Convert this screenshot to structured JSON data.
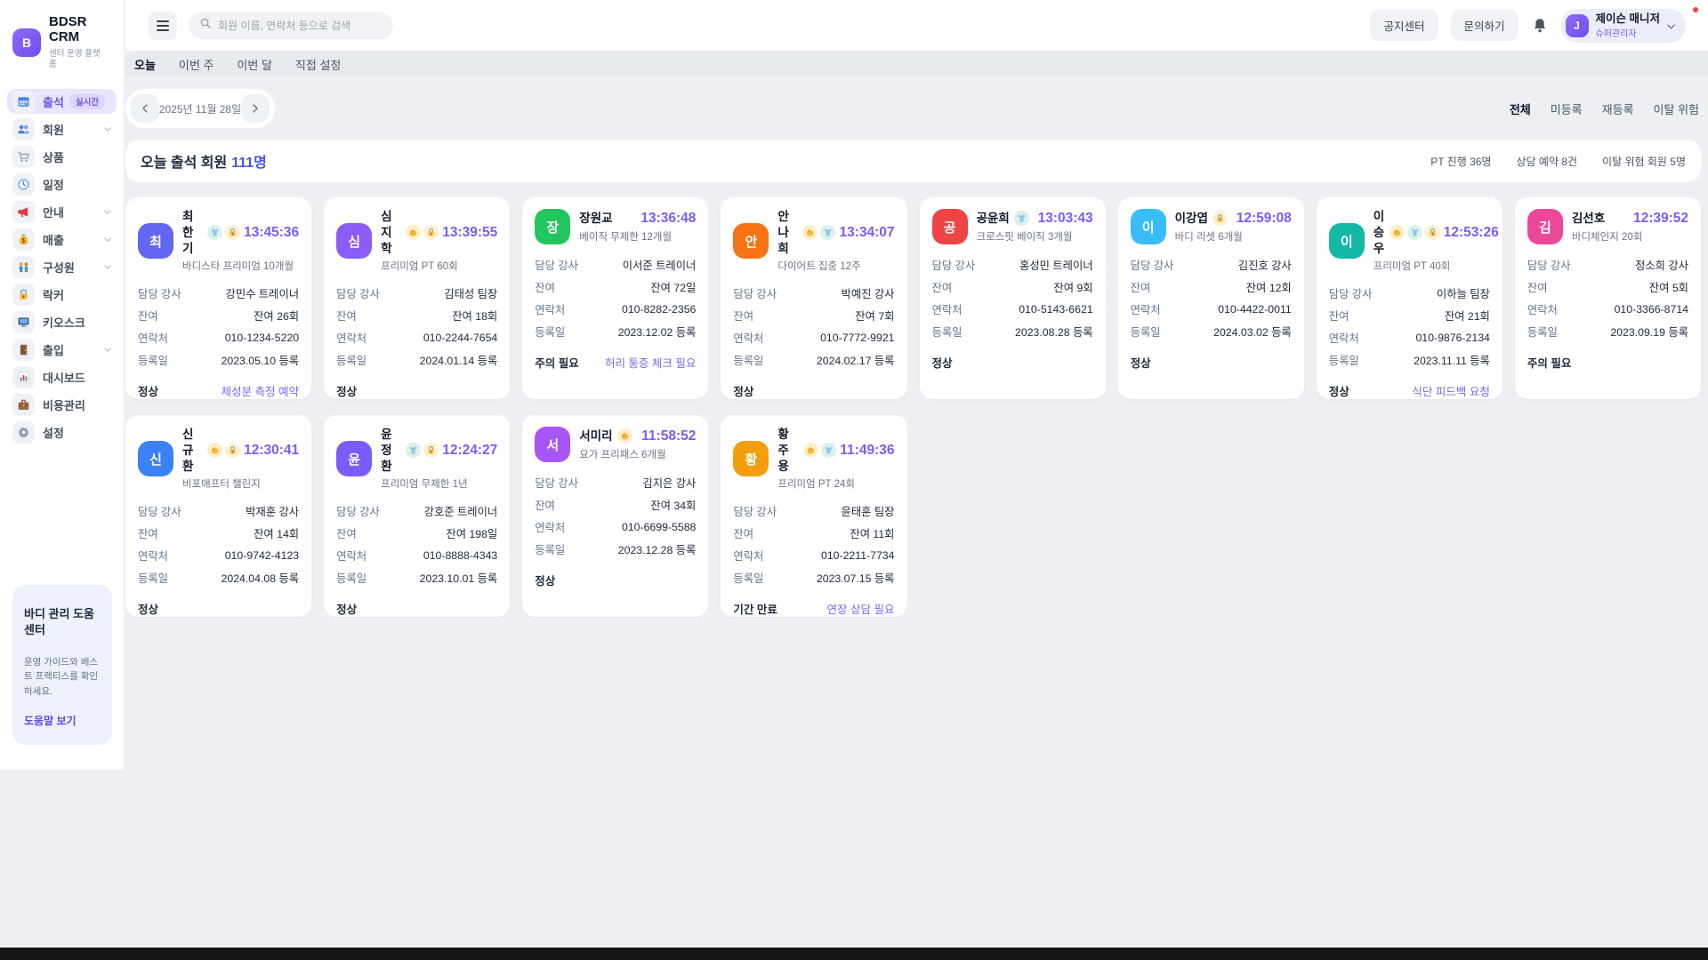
{
  "app": {
    "logo_letter": "B",
    "title": "BDSR CRM",
    "subtitle": "센터 운영 플랫폼"
  },
  "sidebar": {
    "items": [
      {
        "label": "출석",
        "icon": "calendar-icon",
        "badge": "실시간",
        "active": true,
        "chevron": false
      },
      {
        "label": "회원",
        "icon": "members-icon",
        "chevron": true
      },
      {
        "label": "상품",
        "icon": "cart-icon",
        "chevron": false
      },
      {
        "label": "일정",
        "icon": "clock-icon",
        "chevron": false
      },
      {
        "label": "안내",
        "icon": "megaphone-icon",
        "chevron": true
      },
      {
        "label": "매출",
        "icon": "money-icon",
        "chevron": true
      },
      {
        "label": "구성원",
        "icon": "people-icon",
        "chevron": true
      },
      {
        "label": "락커",
        "icon": "locker-icon",
        "chevron": false
      },
      {
        "label": "키오스크",
        "icon": "kiosk-icon",
        "chevron": false
      },
      {
        "label": "출입",
        "icon": "door-icon",
        "chevron": true
      },
      {
        "label": "대시보드",
        "icon": "dashboard-icon",
        "chevron": false
      },
      {
        "label": "비용관리",
        "icon": "briefcase-icon",
        "chevron": false
      },
      {
        "label": "설정",
        "icon": "gear-icon",
        "chevron": false
      }
    ],
    "help_card": {
      "title": "바디 관리 도움 센터",
      "description": "운영 가이드와 베스트 프랙티스를 확인하세요.",
      "link": "도움말 보기"
    }
  },
  "header": {
    "search_placeholder": "회원 이름, 연락처 등으로 검색",
    "notice_button": "공지센터",
    "inquiry_button": "문의하기",
    "user": {
      "avatar": "J",
      "name": "제이슨 매니저",
      "role": "슈퍼관리자"
    }
  },
  "tabs": [
    {
      "label": "오늘",
      "active": true
    },
    {
      "label": "이번 주",
      "active": false
    },
    {
      "label": "이번 달",
      "active": false
    },
    {
      "label": "직접 설정",
      "active": false
    }
  ],
  "date_nav": {
    "date": "2025년 11월 28일"
  },
  "filters": [
    {
      "label": "전체",
      "active": true
    },
    {
      "label": "미등록",
      "active": false
    },
    {
      "label": "재등록",
      "active": false
    },
    {
      "label": "이탈 위험",
      "active": false
    }
  ],
  "summary": {
    "title_prefix": "오늘 출석 회원",
    "count": "111명",
    "stats": [
      "PT 진행 36명",
      "상담 예약 8건",
      "이탈 위험 회원 5명"
    ]
  },
  "labels": {
    "trainer": "담당 강사",
    "remaining": "잔여",
    "contact": "연락처",
    "registered": "등록일"
  },
  "members": [
    {
      "initial": "최",
      "color": "#6366f1",
      "name": "최한기",
      "badges": [
        "shirt",
        "lock"
      ],
      "time": "13:45:36",
      "plan": "바디스타 프리미엄 10개월",
      "trainer": "강민수 트레이너",
      "remaining": "잔여 26회",
      "contact": "010-1234-5220",
      "registered": "2023.05.10 등록",
      "status": "정상",
      "action": "체성분 측정 예약"
    },
    {
      "initial": "심",
      "color": "#8b5cf6",
      "name": "심지학",
      "badges": [
        "muscle",
        "lock"
      ],
      "time": "13:39:55",
      "plan": "프리미엄 PT 60회",
      "trainer": "김태성 팀장",
      "remaining": "잔여 18회",
      "contact": "010-2244-7654",
      "registered": "2024.01.14 등록",
      "status": "정상",
      "action": ""
    },
    {
      "initial": "장",
      "color": "#22c55e",
      "name": "장원교",
      "badges": [],
      "time": "13:36:48",
      "plan": "베이직 무제한 12개월",
      "trainer": "이서준 트레이너",
      "remaining": "잔여 72일",
      "contact": "010-8282-2356",
      "registered": "2023.12.02 등록",
      "status": "주의 필요",
      "action": "허리 통증 체크 필요"
    },
    {
      "initial": "안",
      "color": "#f97316",
      "name": "안나희",
      "badges": [
        "muscle",
        "shirt"
      ],
      "time": "13:34:07",
      "plan": "다이어트 집중 12주",
      "trainer": "박예진 강사",
      "remaining": "잔여 7회",
      "contact": "010-7772-9921",
      "registered": "2024.02.17 등록",
      "status": "정상",
      "action": ""
    },
    {
      "initial": "공",
      "color": "#ef4444",
      "name": "공윤희",
      "badges": [
        "shirt"
      ],
      "time": "13:03:43",
      "plan": "크로스핏 베이직 3개월",
      "trainer": "홍성민 트레이너",
      "remaining": "잔여 9회",
      "contact": "010-5143-6621",
      "registered": "2023.08.28 등록",
      "status": "정상",
      "action": ""
    },
    {
      "initial": "이",
      "color": "#38bdf8",
      "name": "이강엽",
      "badges": [
        "lock"
      ],
      "time": "12:59:08",
      "plan": "바디 리셋 6개월",
      "trainer": "김진호 강사",
      "remaining": "잔여 12회",
      "contact": "010-4422-0011",
      "registered": "2024.03.02 등록",
      "status": "정상",
      "action": ""
    },
    {
      "initial": "이",
      "color": "#14b8a6",
      "name": "이승우",
      "badges": [
        "muscle",
        "shirt",
        "lock"
      ],
      "time": "12:53:26",
      "plan": "프리미엄 PT 40회",
      "trainer": "이하늘 팀장",
      "remaining": "잔여 21회",
      "contact": "010-9876-2134",
      "registered": "2023.11.11 등록",
      "status": "정상",
      "action": "식단 피드백 요청"
    },
    {
      "initial": "김",
      "color": "#ec4899",
      "name": "김선호",
      "badges": [],
      "time": "12:39:52",
      "plan": "바디체인지 20회",
      "trainer": "정소희 강사",
      "remaining": "잔여 5회",
      "contact": "010-3366-8714",
      "registered": "2023.09.19 등록",
      "status": "주의 필요",
      "action": ""
    },
    {
      "initial": "신",
      "color": "#3b82f6",
      "name": "신규환",
      "badges": [
        "muscle",
        "lock"
      ],
      "time": "12:30:41",
      "plan": "비포애프터 챌린지",
      "trainer": "박재훈 강사",
      "remaining": "잔여 14회",
      "contact": "010-9742-4123",
      "registered": "2024.04.08 등록",
      "status": "정상",
      "action": ""
    },
    {
      "initial": "윤",
      "color": "#7c5cfa",
      "name": "윤정환",
      "badges": [
        "shirt",
        "lock"
      ],
      "time": "12:24:27",
      "plan": "프리미엄 무제한 1년",
      "trainer": "강호준 트레이너",
      "remaining": "잔여 198일",
      "contact": "010-8888-4343",
      "registered": "2023.10.01 등록",
      "status": "정상",
      "action": ""
    },
    {
      "initial": "서",
      "color": "#a855f7",
      "name": "서미리",
      "badges": [
        "muscle"
      ],
      "time": "11:58:52",
      "plan": "요가 프리패스 6개월",
      "trainer": "김지은 강사",
      "remaining": "잔여 34회",
      "contact": "010-6699-5588",
      "registered": "2023.12.28 등록",
      "status": "정상",
      "action": ""
    },
    {
      "initial": "황",
      "color": "#f59e0b",
      "name": "황주용",
      "badges": [
        "muscle",
        "shirt"
      ],
      "time": "11:49:36",
      "plan": "프리미엄 PT 24회",
      "trainer": "윤태훈 팀장",
      "remaining": "잔여 11회",
      "contact": "010-2211-7734",
      "registered": "2023.07.15 등록",
      "status": "기간 만료",
      "action": "연장 상담 필요"
    }
  ]
}
